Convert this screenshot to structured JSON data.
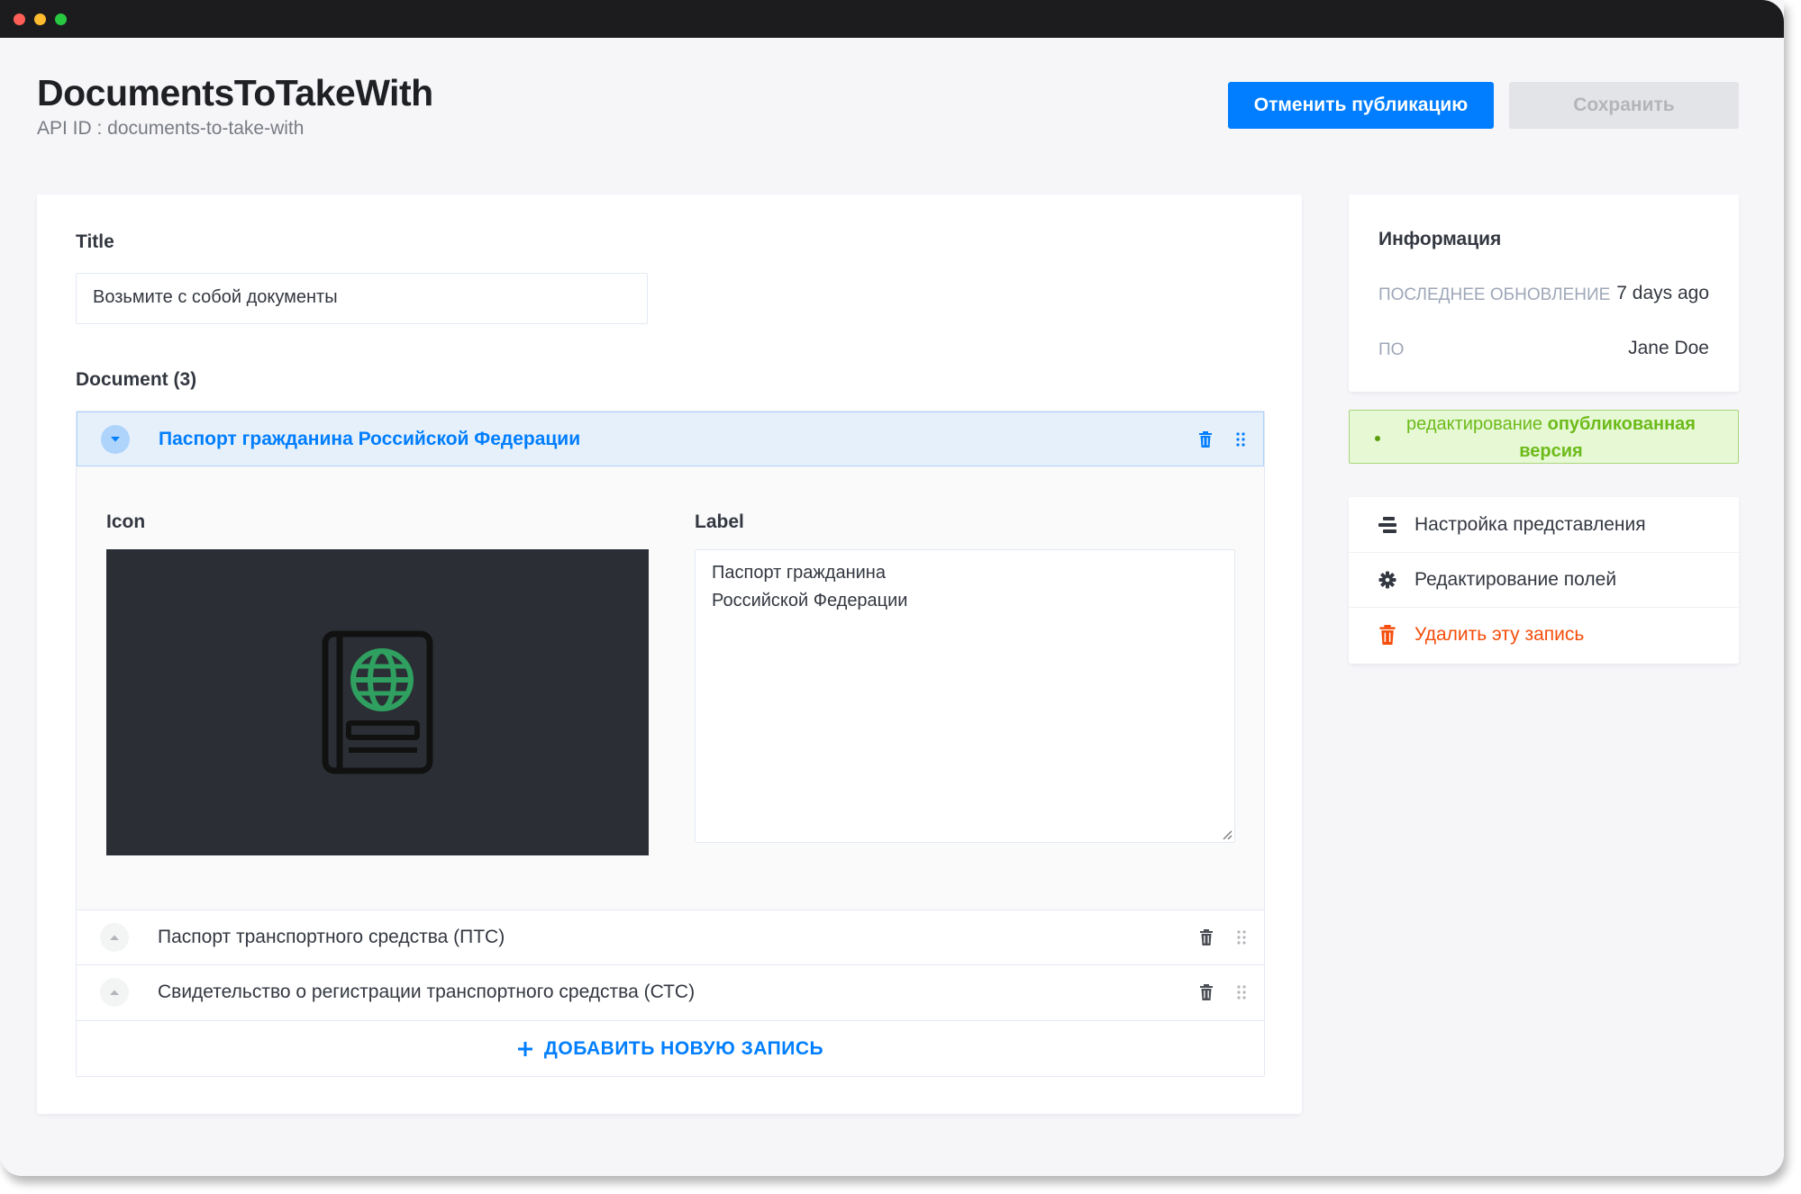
{
  "window": {
    "title": "DocumentsToTakeWith",
    "api_id": "API ID : documents-to-take-with"
  },
  "header": {
    "unpublish_label": "Отменить публикацию",
    "save_label": "Сохранить"
  },
  "form": {
    "title_label": "Title",
    "title_value": "Возьмите с собой документы",
    "document_label": "Document (3)",
    "documents": [
      {
        "name": "Паспорт гражданина Российской Федерации",
        "expanded": true
      },
      {
        "name": "Паспорт транспортного средства (ПТС)",
        "expanded": false
      },
      {
        "name": "Свидетельство о регистрации транспортного средства (СТС)",
        "expanded": false
      }
    ],
    "expanded_item": {
      "icon_label": "Icon",
      "icon_name": "passport-icon",
      "label_label": "Label",
      "label_value": "Паспорт гражданина\nРоссийской Федерации"
    },
    "add_entry_label": "ДОБАВИТЬ НОВУЮ ЗАПИСЬ"
  },
  "info": {
    "title": "Информация",
    "last_update_key": "последнее обновление",
    "last_update_value": "7 days ago",
    "by_key": "по",
    "by_value": "Jane Doe"
  },
  "status": {
    "prefix": "редактирование",
    "strong": "опубликованная версия"
  },
  "actions": [
    {
      "label": "Настройка представления",
      "icon": "layout-icon"
    },
    {
      "label": "Редактирование полей",
      "icon": "gear-icon"
    },
    {
      "label": "Удалить эту запись",
      "icon": "trash-icon"
    }
  ],
  "colors": {
    "primary": "#007eff",
    "danger": "#f64d0a",
    "success": "#6dbb1a",
    "icon_green": "#2fa05f"
  }
}
